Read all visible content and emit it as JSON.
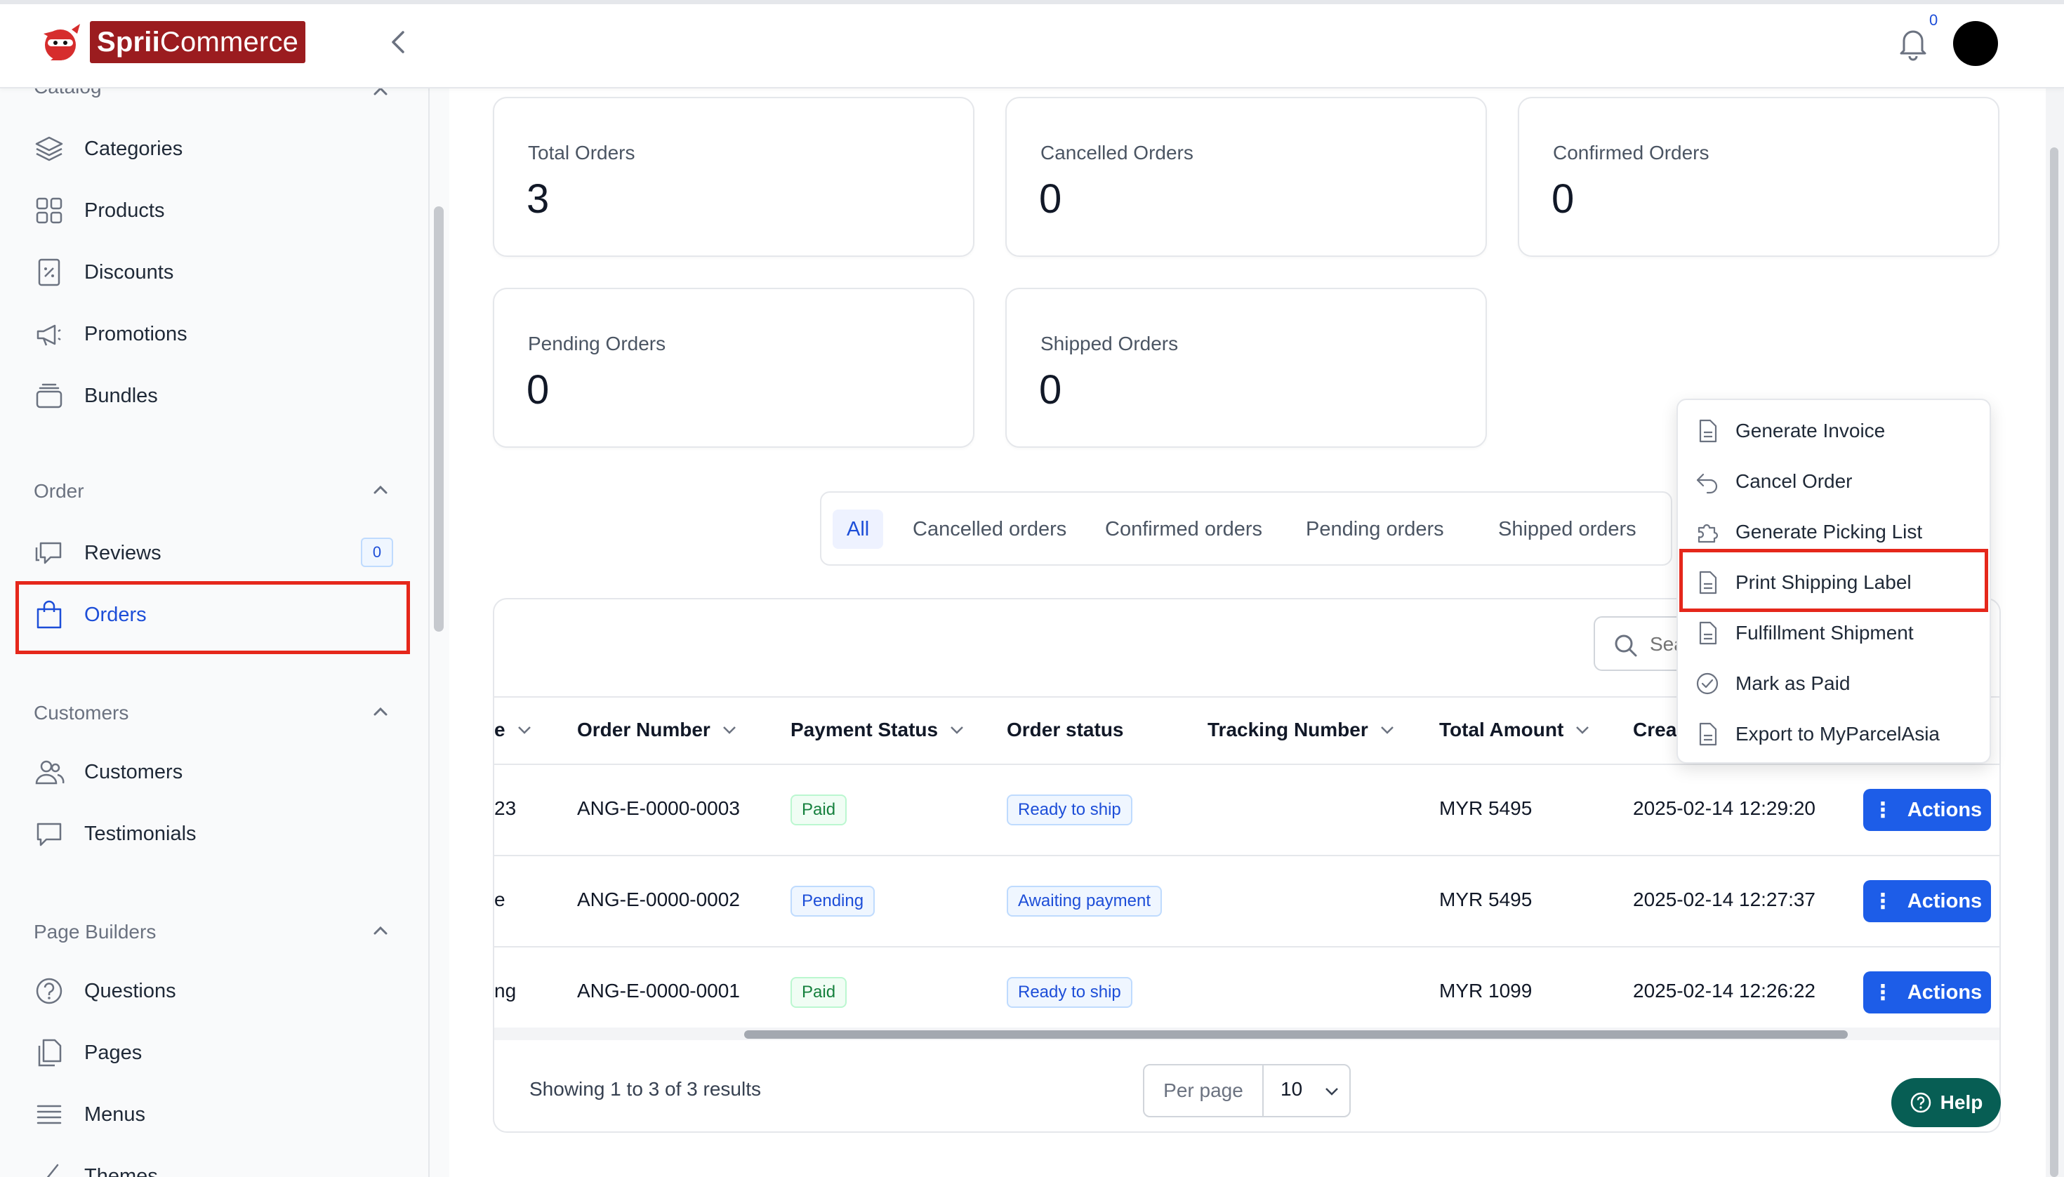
{
  "brand": {
    "name_bold": "Sprii",
    "name_rest": "Commerce"
  },
  "header": {
    "notification_count": "0"
  },
  "sidebar": {
    "catalog_title": "Catalog",
    "catalog_items": [
      {
        "label": "Categories",
        "icon": "layers-icon"
      },
      {
        "label": "Products",
        "icon": "grid-icon"
      },
      {
        "label": "Discounts",
        "icon": "discount-tag-icon"
      },
      {
        "label": "Promotions",
        "icon": "megaphone-icon"
      },
      {
        "label": "Bundles",
        "icon": "stack-box-icon"
      }
    ],
    "order_title": "Order",
    "order_items": [
      {
        "label": "Reviews",
        "icon": "chat-icon",
        "badge": "0"
      },
      {
        "label": "Orders",
        "icon": "shopping-bag-icon"
      }
    ],
    "customers_title": "Customers",
    "customers_items": [
      {
        "label": "Customers",
        "icon": "users-icon"
      },
      {
        "label": "Testimonials",
        "icon": "speech-icon"
      }
    ],
    "page_builders_title": "Page Builders",
    "page_builders_items": [
      {
        "label": "Questions",
        "icon": "question-icon"
      },
      {
        "label": "Pages",
        "icon": "pages-icon"
      },
      {
        "label": "Menus",
        "icon": "menu-icon"
      },
      {
        "label": "Themes",
        "icon": "brush-icon"
      }
    ]
  },
  "stats": [
    {
      "label": "Total Orders",
      "value": "3"
    },
    {
      "label": "Cancelled Orders",
      "value": "0"
    },
    {
      "label": "Confirmed Orders",
      "value": "0"
    },
    {
      "label": "Pending Orders",
      "value": "0"
    },
    {
      "label": "Shipped Orders",
      "value": "0"
    }
  ],
  "tabs": [
    "All",
    "Cancelled orders",
    "Confirmed orders",
    "Pending orders",
    "Shipped orders"
  ],
  "search": {
    "placeholder": "Search"
  },
  "table": {
    "columns": [
      "e",
      "Order Number",
      "Payment Status",
      "Order status",
      "Tracking Number",
      "Total Amount",
      "Crea"
    ],
    "rows": [
      {
        "name": "23",
        "order_number": "ANG-E-0000-0003",
        "payment_status": "Paid",
        "order_status": "Ready to ship",
        "tracking": "",
        "total": "MYR 5495",
        "created": "2025-02-14 12:29:20",
        "action": "Actions"
      },
      {
        "name": "e",
        "order_number": "ANG-E-0000-0002",
        "payment_status": "Pending",
        "order_status": "Awaiting payment",
        "tracking": "",
        "total": "MYR 5495",
        "created": "2025-02-14 12:27:37",
        "action": "Actions"
      },
      {
        "name": "ng",
        "order_number": "ANG-E-0000-0001",
        "payment_status": "Paid",
        "order_status": "Ready to ship",
        "tracking": "",
        "total": "MYR 1099",
        "created": "2025-02-14 12:26:22",
        "action": "Actions"
      }
    ]
  },
  "pagination": {
    "summary": "Showing 1 to 3 of 3 results",
    "per_page_label": "Per page",
    "per_page_value": "10"
  },
  "help": {
    "label": "Help"
  },
  "actions_menu": [
    {
      "label": "Generate Invoice",
      "icon": "document-icon"
    },
    {
      "label": "Cancel Order",
      "icon": "undo-arrow-icon"
    },
    {
      "label": "Generate Picking List",
      "icon": "puzzle-icon"
    },
    {
      "label": "Print Shipping Label",
      "icon": "document-icon"
    },
    {
      "label": "Fulfillment Shipment",
      "icon": "document-icon"
    },
    {
      "label": "Mark as Paid",
      "icon": "check-circle-icon"
    },
    {
      "label": "Export to MyParcelAsia",
      "icon": "document-icon"
    }
  ],
  "colors": {
    "brand": "#9b1c1f",
    "accent": "#1d5de8",
    "highlight": "#e5271b",
    "help": "#075e54"
  }
}
